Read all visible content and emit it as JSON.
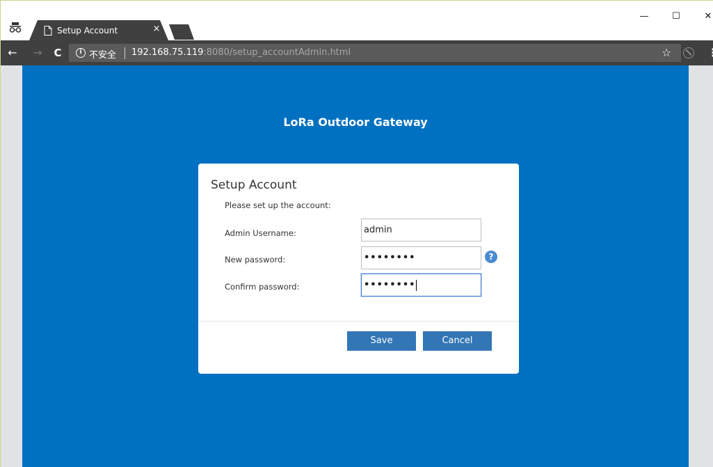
{
  "browser": {
    "tab": {
      "title": "Setup Account",
      "close_glyph": "×"
    },
    "window_controls": {
      "minimize": "—",
      "maximize": "☐",
      "close": "✕"
    },
    "nav": {
      "back": "←",
      "forward": "→",
      "reload": "C"
    },
    "address_bar": {
      "security_label": "不安全",
      "url_host": "192.168.75.119",
      "url_rest": ":8080/setup_accountAdmin.html"
    },
    "icons": {
      "incognito": "incognito-icon",
      "info": "info-icon",
      "star": "star-icon",
      "extension": "blocked-extension-icon",
      "menu": "menu-icon"
    }
  },
  "page": {
    "header_title": "LoRa Outdoor Gateway",
    "dialog": {
      "title": "Setup Account",
      "description": "Please set up the account:",
      "fields": {
        "username_label": "Admin Username:",
        "username_value": "admin",
        "new_password_label": "New password:",
        "new_password_value": "••••••••",
        "confirm_password_label": "Confirm password:",
        "confirm_password_value": "••••••••"
      },
      "help_glyph": "?",
      "save_label": "Save",
      "cancel_label": "Cancel"
    }
  },
  "colors": {
    "page_background": "#0070c0",
    "button": "#3276b6",
    "toolbar": "#404040",
    "help_icon": "#4a8bd0"
  }
}
